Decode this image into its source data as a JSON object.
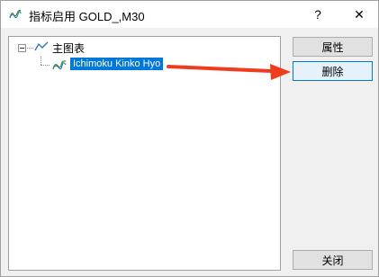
{
  "window": {
    "title": "指标启用 GOLD_,M30",
    "help_label": "?",
    "close_label": "✕"
  },
  "tree": {
    "root_label": "主图表",
    "child_label": "Ichimoku Kinko Hyo"
  },
  "buttons": {
    "properties": "属性",
    "delete": "删除",
    "close": "关闭"
  },
  "colors": {
    "selection": "#0078d7",
    "annotation_arrow": "#f03c1e"
  },
  "icons": {
    "title": "indicator-icon",
    "root": "chart-line-icon",
    "child": "indicator-icon"
  }
}
